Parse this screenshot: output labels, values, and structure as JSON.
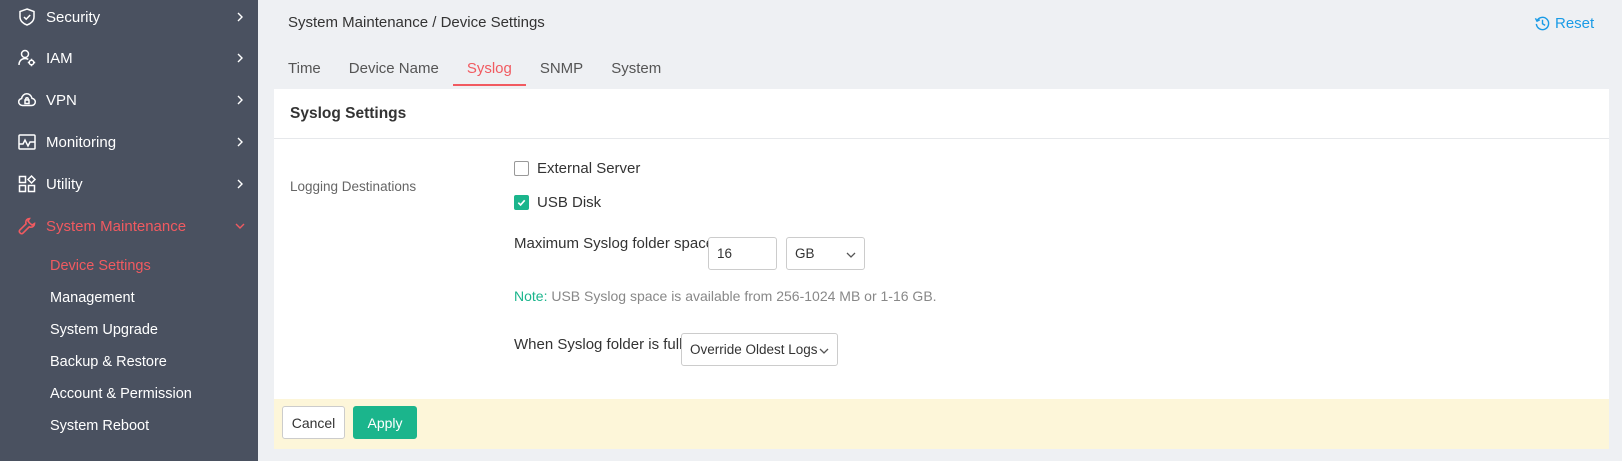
{
  "sidebar": {
    "items": [
      {
        "label": "Security",
        "icon": "shield-icon"
      },
      {
        "label": "IAM",
        "icon": "user-gear-icon"
      },
      {
        "label": "VPN",
        "icon": "cloud-lock-icon"
      },
      {
        "label": "Monitoring",
        "icon": "monitor-chart-icon"
      },
      {
        "label": "Utility",
        "icon": "grid-tools-icon"
      },
      {
        "label": "System Maintenance",
        "icon": "wrench-icon"
      }
    ],
    "sub_items": [
      "Device Settings",
      "Management",
      "System Upgrade",
      "Backup & Restore",
      "Account & Permission",
      "System Reboot"
    ]
  },
  "header": {
    "breadcrumb": "System Maintenance / Device Settings",
    "reset_label": "Reset"
  },
  "tabs": [
    "Time",
    "Device Name",
    "Syslog",
    "SNMP",
    "System"
  ],
  "panel": {
    "title": "Syslog Settings",
    "logging_destinations_label": "Logging Destinations",
    "external_server_label": "External Server",
    "external_server_checked": false,
    "usb_disk_label": "USB Disk",
    "usb_disk_checked": true,
    "max_space_label": "Maximum Syslog folder space",
    "max_space_value": "16",
    "max_space_unit": "GB",
    "note_key": "Note:",
    "note_text": " USB Syslog space is available from 256-1024 MB or 1-16 GB.",
    "when_full_label": "When Syslog folder is full:",
    "when_full_value": "Override Oldest Logs"
  },
  "footer": {
    "cancel_label": "Cancel",
    "apply_label": "Apply"
  },
  "colors": {
    "sidebar_bg": "#4a5160",
    "accent_red": "#f15a60",
    "accent_green": "#1bb58c",
    "link_blue": "#1a9be6",
    "footer_bg": "#fdf6d9"
  }
}
